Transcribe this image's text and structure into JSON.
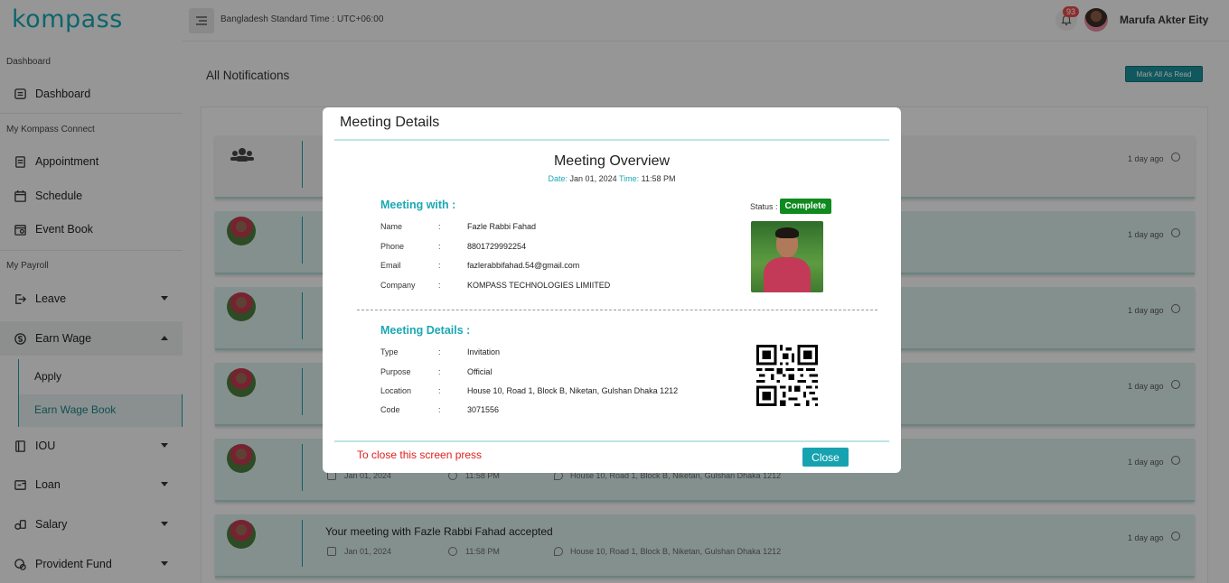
{
  "app": {
    "logo": "kompass"
  },
  "topbar": {
    "timezone": "Bangladesh Standard Time : UTC+06:00",
    "notification_count": "93",
    "user_name": "Marufa Akter Eity"
  },
  "sidebar": {
    "sections": [
      "Dashboard",
      "My Kompass Connect",
      "My Payroll"
    ],
    "items": [
      {
        "label": "Dashboard",
        "icon": "dashboard-icon"
      },
      {
        "label": "Appointment",
        "icon": "appointment-icon"
      },
      {
        "label": "Schedule",
        "icon": "calendar-icon"
      },
      {
        "label": "Event Book",
        "icon": "event-book-icon"
      },
      {
        "label": "Leave",
        "icon": "leave-icon"
      },
      {
        "label": "Earn Wage",
        "icon": "earn-wage-icon"
      },
      {
        "label": "IOU",
        "icon": "iou-icon"
      },
      {
        "label": "Loan",
        "icon": "loan-icon"
      },
      {
        "label": "Salary",
        "icon": "salary-icon"
      },
      {
        "label": "Provident Fund",
        "icon": "provident-fund-icon"
      }
    ],
    "sub_items": [
      "Apply",
      "Earn Wage Book"
    ]
  },
  "main": {
    "page_title": "All Notifications",
    "mark_all_label": "Mark All As Read",
    "notifications": [
      {
        "time": "1 day ago"
      },
      {
        "time": "1 day ago"
      },
      {
        "time": "1 day ago"
      },
      {
        "time": "1 day ago"
      },
      {
        "time": "1 day ago",
        "date": "Jan 01, 2024",
        "clock": "11:58 PM",
        "location": "House 10, Road 1, Block B, Niketan, Gulshan Dhaka 1212"
      },
      {
        "time": "1 day ago",
        "message": "Your meeting with Fazle Rabbi Fahad accepted",
        "date": "Jan 01, 2024",
        "clock": "11:58 PM",
        "location": "House 10, Road 1, Block B, Niketan, Gulshan Dhaka 1212"
      }
    ]
  },
  "modal": {
    "title": "Meeting Details",
    "overview_title": "Meeting Overview",
    "date_label": "Date:",
    "date_value": "Jan 01, 2024",
    "time_label": "Time:",
    "time_value": "11:58 PM",
    "meeting_with_heading": "Meeting with :",
    "status_label": "Status :",
    "status_value": "Complete",
    "separator": ":",
    "person_rows": [
      {
        "label": "Name",
        "value": "Fazle Rabbi Fahad"
      },
      {
        "label": "Phone",
        "value": "8801729992254"
      },
      {
        "label": "Email",
        "value": "fazlerabbifahad.54@gmail.com"
      },
      {
        "label": "Company",
        "value": "KOMPASS TECHNOLOGIES LIMIITED"
      }
    ],
    "details_heading": "Meeting Details :",
    "detail_rows": [
      {
        "label": "Type",
        "value": "Invitation"
      },
      {
        "label": "Purpose",
        "value": "Official"
      },
      {
        "label": "Location",
        "value": "House 10, Road 1, Block B, Niketan, Gulshan Dhaka 1212"
      },
      {
        "label": "Code",
        "value": "3071556"
      }
    ],
    "close_hint": "To close this screen press",
    "close_label": "Close"
  },
  "colors": {
    "accent": "#17a2b0",
    "status_complete": "#0f8a1f",
    "badge": "#e04a4a"
  }
}
